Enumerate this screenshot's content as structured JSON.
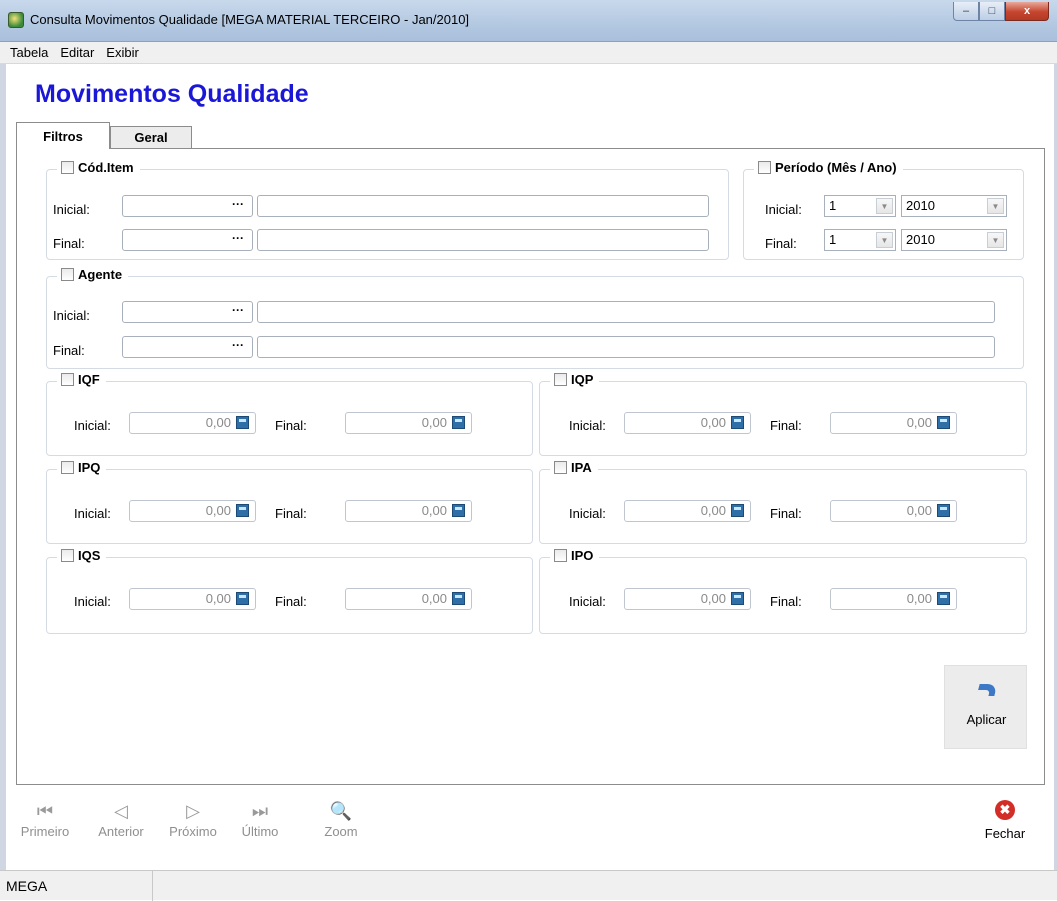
{
  "window": {
    "title": "Consulta Movimentos Qualidade [MEGA MATERIAL TERCEIRO - Jan/2010]",
    "minimize_glyph": "–",
    "maximize_glyph": "□",
    "close_glyph": "x"
  },
  "menu": [
    "Tabela",
    "Editar",
    "Exibir"
  ],
  "page_title": "Movimentos Qualidade",
  "tabs": [
    {
      "label": "Filtros",
      "active": true
    },
    {
      "label": "Geral",
      "active": false
    }
  ],
  "cod_item": {
    "label": "Cód.Item",
    "inicial_label": "Inicial:",
    "final_label": "Final:",
    "lookup": "···"
  },
  "periodo": {
    "label": "Período (Mês / Ano)",
    "inicial_label": "Inicial:",
    "final_label": "Final:",
    "inicial_mes": "1",
    "inicial_ano": "2010",
    "final_mes": "1",
    "final_ano": "2010"
  },
  "agente": {
    "label": "Agente",
    "inicial_label": "Inicial:",
    "final_label": "Final:",
    "lookup": "···"
  },
  "indices": [
    {
      "label": "IQF",
      "inicial_label": "Inicial:",
      "final_label": "Final:",
      "inicial": "0,00",
      "final": "0,00"
    },
    {
      "label": "IQP",
      "inicial_label": "Inicial:",
      "final_label": "Final:",
      "inicial": "0,00",
      "final": "0,00"
    },
    {
      "label": "IPQ",
      "inicial_label": "Inicial:",
      "final_label": "Final:",
      "inicial": "0,00",
      "final": "0,00"
    },
    {
      "label": "IPA",
      "inicial_label": "Inicial:",
      "final_label": "Final:",
      "inicial": "0,00",
      "final": "0,00"
    },
    {
      "label": "IQS",
      "inicial_label": "Inicial:",
      "final_label": "Final:",
      "inicial": "0,00",
      "final": "0,00"
    },
    {
      "label": "IPO",
      "inicial_label": "Inicial:",
      "final_label": "Final:",
      "inicial": "0,00",
      "final": "0,00"
    }
  ],
  "apply_label": "Aplicar",
  "navigation": [
    {
      "label": "Primeiro",
      "icon": "first-record-icon",
      "glyph": "⏮"
    },
    {
      "label": "Anterior",
      "icon": "previous-record-icon",
      "glyph": "◁"
    },
    {
      "label": "Próximo",
      "icon": "next-record-icon",
      "glyph": "▷"
    },
    {
      "label": "Último",
      "icon": "last-record-icon",
      "glyph": "⏭"
    },
    {
      "label": "Zoom",
      "icon": "zoom-icon",
      "glyph": "🔍"
    }
  ],
  "close_label": "Fechar",
  "close_glyph": "✖",
  "status": "MEGA",
  "colors": {
    "title_blue": "#1b17d6",
    "close_red": "#d32d27"
  }
}
